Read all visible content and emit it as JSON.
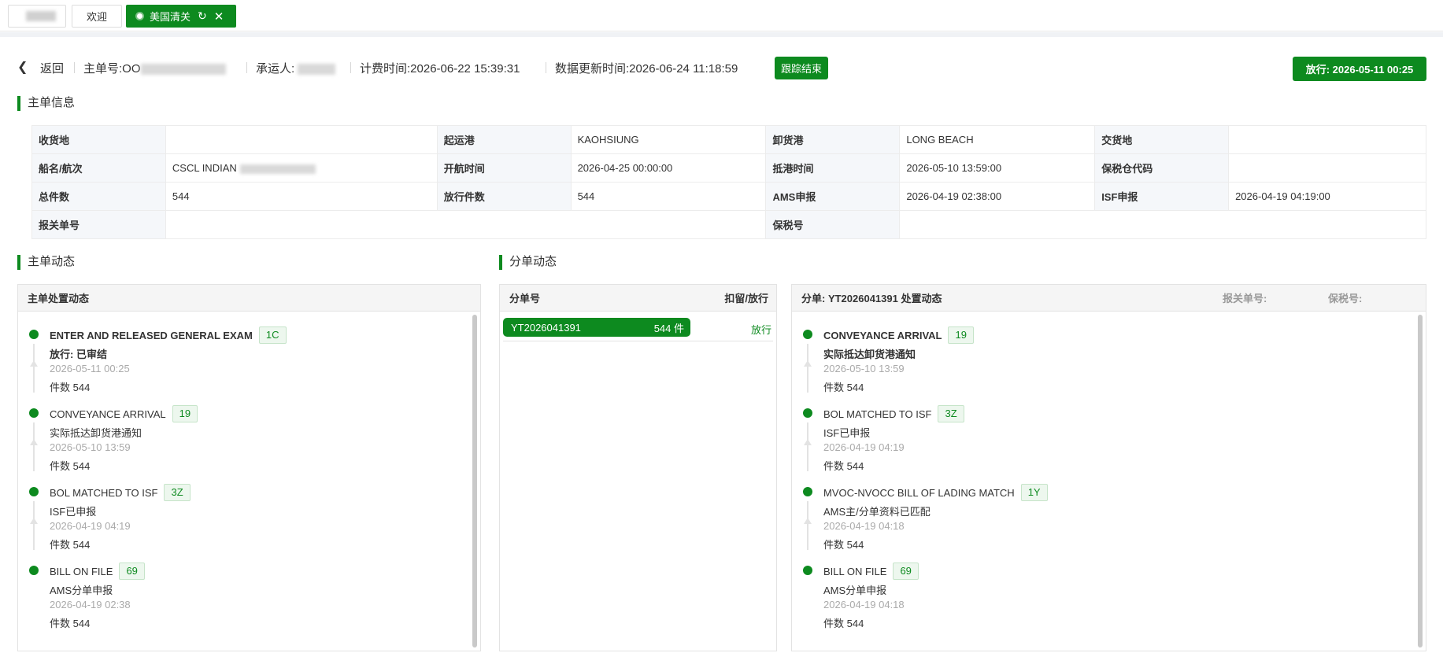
{
  "tabs": {
    "welcome": "欢迎",
    "active": "美国清关"
  },
  "header": {
    "back": "返回",
    "master_label": "主单号:",
    "master_prefix": "OO",
    "carrier_label": "承运人:",
    "billing_label": "计费时间:",
    "billing_time": "2026-06-22 15:39:31",
    "update_label": "数据更新时间:",
    "update_time": "2026-06-24 11:18:59",
    "track_end": "跟踪结束",
    "release_badge": "放行: 2026-05-11 00:25"
  },
  "sections": {
    "master_info": "主单信息",
    "master_dynamic": "主单动态",
    "sub_dynamic": "分单动态"
  },
  "info": {
    "r1": {
      "l1": "收货地",
      "v1": "",
      "l2": "起运港",
      "v2": "KAOHSIUNG",
      "l3": "卸货港",
      "v3": "LONG BEACH",
      "l4": "交货地",
      "v4": ""
    },
    "r2": {
      "l1": "船名/航次",
      "v1": "CSCL INDIAN",
      "l2": "开航时间",
      "v2": "2026-04-25 00:00:00",
      "l3": "抵港时间",
      "v3": "2026-05-10 13:59:00",
      "l4": "保税仓代码",
      "v4": ""
    },
    "r3": {
      "l1": "总件数",
      "v1": "544",
      "l2": "放行件数",
      "v2": "544",
      "l3": "AMS申报",
      "v3": "2026-04-19 02:38:00",
      "l4": "ISF申报",
      "v4": "2026-04-19 04:19:00"
    },
    "r4": {
      "l1": "报关单号",
      "v1": "",
      "l3": "保税号",
      "v3": ""
    }
  },
  "master_panel": {
    "head": "主单处置动态",
    "events": [
      {
        "title": "ENTER AND RELEASED GENERAL EXAM",
        "code": "1C",
        "desc": "放行: 已审结",
        "time": "2026-05-11 00:25",
        "count": "件数 544"
      },
      {
        "title": "CONVEYANCE ARRIVAL",
        "code": "19",
        "desc": "实际抵达卸货港通知",
        "time": "2026-05-10 13:59",
        "count": "件数 544"
      },
      {
        "title": "BOL MATCHED TO ISF",
        "code": "3Z",
        "desc": "ISF已申报",
        "time": "2026-04-19 04:19",
        "count": "件数 544"
      },
      {
        "title": "BILL ON FILE",
        "code": "69",
        "desc": "AMS分单申报",
        "time": "2026-04-19 02:38",
        "count": "件数 544"
      }
    ]
  },
  "sub_list": {
    "col_no": "分单号",
    "col_status": "扣留/放行",
    "rows": [
      {
        "no": "YT2026041391",
        "count": "544 件",
        "status": "放行"
      }
    ]
  },
  "sub_panel": {
    "head": "分单: YT2026041391 处置动态",
    "customs_label": "报关单号:",
    "bond_label": "保税号:",
    "events": [
      {
        "title": "CONVEYANCE ARRIVAL",
        "code": "19",
        "desc": "实际抵达卸货港通知",
        "time": "2026-05-10 13:59",
        "count": "件数 544"
      },
      {
        "title": "BOL MATCHED TO ISF",
        "code": "3Z",
        "desc": "ISF已申报",
        "time": "2026-04-19 04:19",
        "count": "件数 544"
      },
      {
        "title": "MVOC-NVOCC BILL OF LADING MATCH",
        "code": "1Y",
        "desc": "AMS主/分单资料已匹配",
        "time": "2026-04-19 04:18",
        "count": "件数 544"
      },
      {
        "title": "BILL ON FILE",
        "code": "69",
        "desc": "AMS分单申报",
        "time": "2026-04-19 04:18",
        "count": "件数 544"
      }
    ]
  },
  "colors": {
    "brand": "#0d8a1f"
  },
  "icons": {
    "back": "chevron-left-icon",
    "refresh": "refresh-icon",
    "close": "close-icon",
    "tab_dot": "dot-icon"
  }
}
